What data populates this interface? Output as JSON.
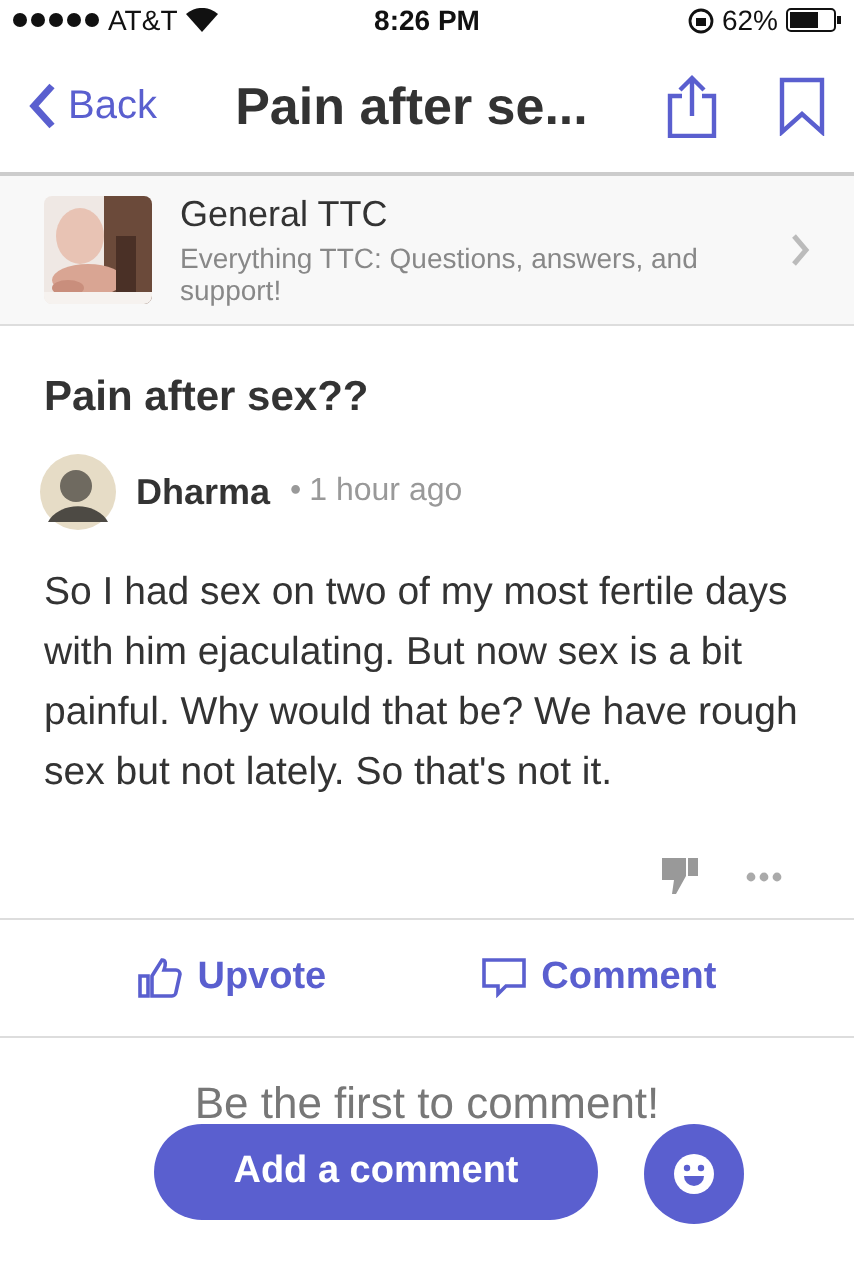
{
  "status_bar": {
    "carrier": "AT&T",
    "time": "8:26 PM",
    "battery": "62%"
  },
  "nav": {
    "back": "Back",
    "title": "Pain after se..."
  },
  "group": {
    "name": "General TTC",
    "description": "Everything TTC: Questions, answers, and support!"
  },
  "post": {
    "title": "Pain after sex??",
    "author": "Dharma",
    "separator": "•",
    "time": "1 hour ago",
    "body": "So I had sex on two of my most fertile days with him ejaculating. But now sex is a bit painful. Why would that be? We have rough sex but not lately. So that's not it."
  },
  "actions": [
    {
      "label": "Upvote",
      "kind": "upvote"
    },
    {
      "label": "Comment",
      "kind": "comment"
    }
  ],
  "empty_comments": "Be the first to comment!",
  "add_comment": "Add a comment"
}
